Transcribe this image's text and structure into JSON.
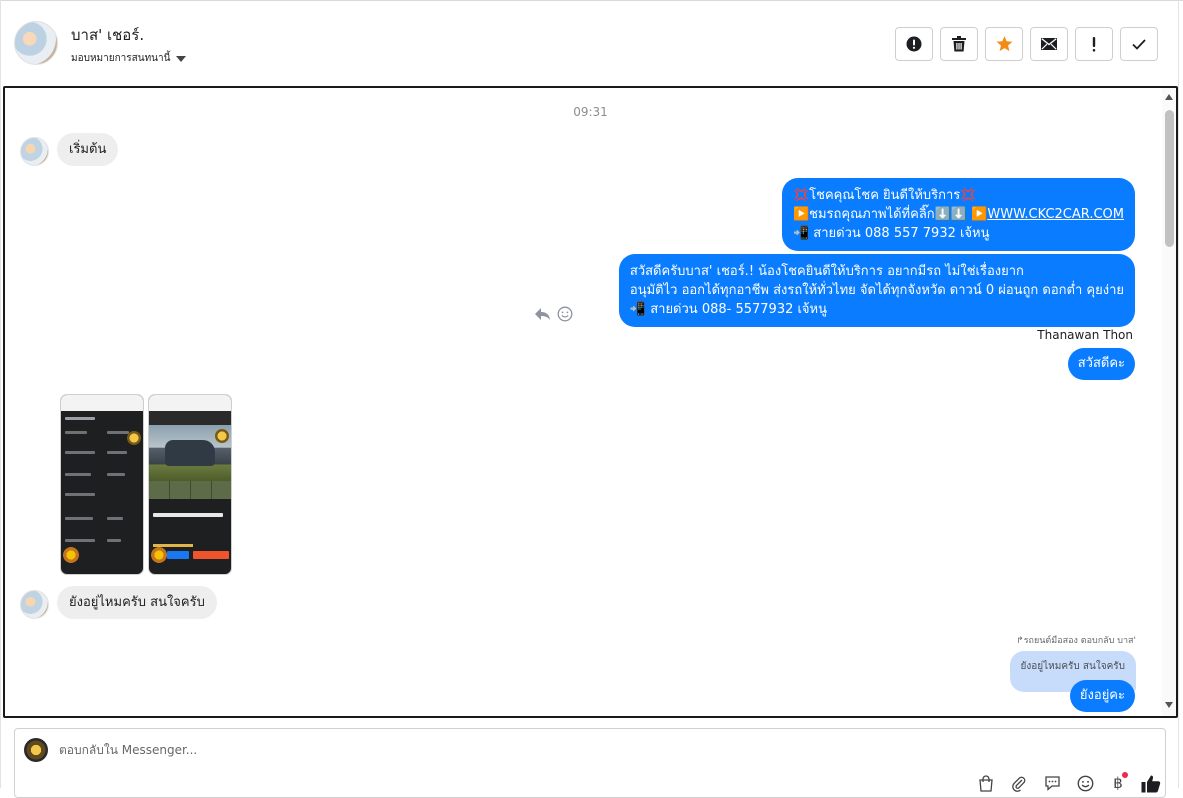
{
  "header": {
    "contact_name": "บาส' เชอร์.",
    "assign_label": "มอบหมายการสนทนานี้",
    "toolbar": [
      {
        "name": "spam-button",
        "icon": "alert-circle-icon"
      },
      {
        "name": "delete-button",
        "icon": "trash-icon"
      },
      {
        "name": "star-button",
        "icon": "star-icon"
      },
      {
        "name": "mark-unread-button",
        "icon": "envelope-icon"
      },
      {
        "name": "follow-up-button",
        "icon": "exclamation-icon"
      },
      {
        "name": "mark-done-button",
        "icon": "check-icon"
      }
    ],
    "colors": {
      "star": "#f28c18"
    }
  },
  "chat": {
    "timestamp": "09:31",
    "messages": {
      "in_1": "เริ่มต้น",
      "out_1": {
        "line1": "💢โชคคุณโชค ยินดีให้บริการ💢",
        "line2_prefix": "▶️ชมรถคุณภาพได้ที่คลิ๊ก⬇️⬇️ ▶️",
        "line2_link": "WWW.CKC2CAR.COM",
        "line3": "📲 สายด่วน 088 557 7932 เจ้หนู"
      },
      "out_2": {
        "line1": "สวัสดีครับบาส' เชอร์.! น้องโชคยินดีให้บริการ อยากมีรถ ไม่ใช่เรื่องยาก",
        "line2": "อนุมัติไว ออกได้ทุกอาชีพ ส่งรถให้ทั่วไทย จัดได้ทุกจังหวัด ดาวน์ 0 ผ่อนถูก ดอกต่ำ คุยง่าย",
        "line3": "📲 สายด่วน 088- 5577932 เจ้หนู"
      },
      "sender_name": "Thanawan Thon",
      "out_3": "สวัสดีคะ",
      "in_2": "ยังอยู่ไหมครับ สนใจครับ",
      "reply_header": "↱รถยนต์มือสอง ตอบกลับ บาส'",
      "reply_quote": "ยังอยู่ไหมครับ สนใจครับ",
      "out_4": "ยังอยู่คะ"
    },
    "colors": {
      "outgoing": "#0a7cff",
      "incoming": "#eeeeee",
      "quote": "#c7dcfa"
    }
  },
  "composer": {
    "placeholder": "ตอบกลับใน Messenger...",
    "icons": [
      "shopping-bag-icon",
      "paperclip-icon",
      "saved-reply-icon",
      "emoji-icon",
      "baht-payment-icon",
      "like-icon"
    ],
    "baht_symbol": "฿"
  }
}
